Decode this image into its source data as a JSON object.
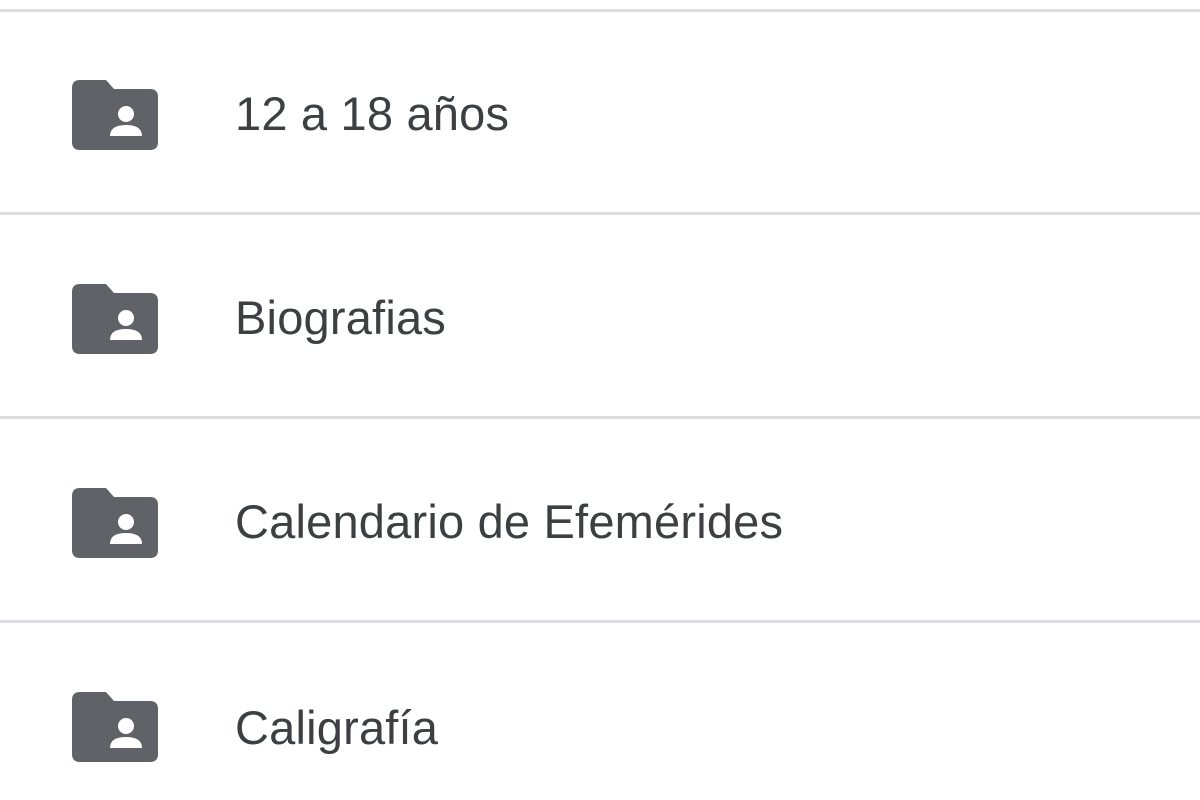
{
  "folder_list": {
    "items": [
      {
        "label": "12 a 18 años",
        "icon": "shared-folder-icon"
      },
      {
        "label": "Biografias",
        "icon": "shared-folder-icon"
      },
      {
        "label": "Calendario de Efemérides",
        "icon": "shared-folder-icon"
      },
      {
        "label": "Caligrafía",
        "icon": "shared-folder-icon"
      }
    ]
  },
  "colors": {
    "icon": "#5f6368",
    "text": "#3c4043",
    "divider": "#dadce0",
    "background": "#ffffff"
  }
}
